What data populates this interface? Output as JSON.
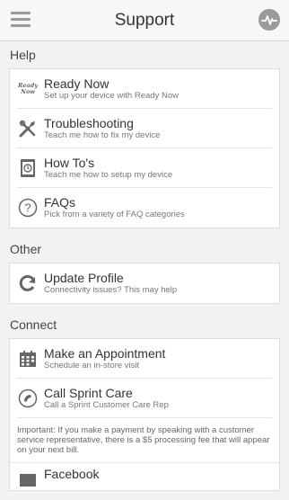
{
  "header": {
    "title": "Support"
  },
  "sections": {
    "help": {
      "title": "Help",
      "items": [
        {
          "title": "Ready Now",
          "subtitle": "Set up your device with Ready Now",
          "icon_text_1": "Ready",
          "icon_text_2": "Now"
        },
        {
          "title": "Troubleshooting",
          "subtitle": "Teach me how to fix my device"
        },
        {
          "title": "How To's",
          "subtitle": "Teach me how to setup my device"
        },
        {
          "title": "FAQs",
          "subtitle": "Pick from a variety of FAQ categories"
        }
      ]
    },
    "other": {
      "title": "Other",
      "items": [
        {
          "title": "Update Profile",
          "subtitle": "Connectivity issues? This may help"
        }
      ]
    },
    "connect": {
      "title": "Connect",
      "items": [
        {
          "title": "Make an Appointment",
          "subtitle": "Schedule an in-store visit"
        },
        {
          "title": "Call Sprint Care",
          "subtitle": "Call a Sprint Customer Care Rep"
        }
      ],
      "note": "Important: If you make a payment by speaking with a customer service representative, there is a $5 processing fee that will appear on your next bill.",
      "partial_item": {
        "title": "Facebook"
      }
    }
  },
  "icons": {
    "menu": "hamburger-menu-icon",
    "pulse": "pulse-icon",
    "ready_now": "ready-now-icon",
    "troubleshooting": "tools-icon",
    "how_to": "device-icon",
    "faqs": "question-icon",
    "update_profile": "refresh-icon",
    "appointment": "calendar-icon",
    "call": "phone-icon",
    "facebook": "facebook-icon"
  },
  "colors": {
    "icon_gray": "#9a9a9a",
    "text": "#333333",
    "subtext": "#777777"
  }
}
